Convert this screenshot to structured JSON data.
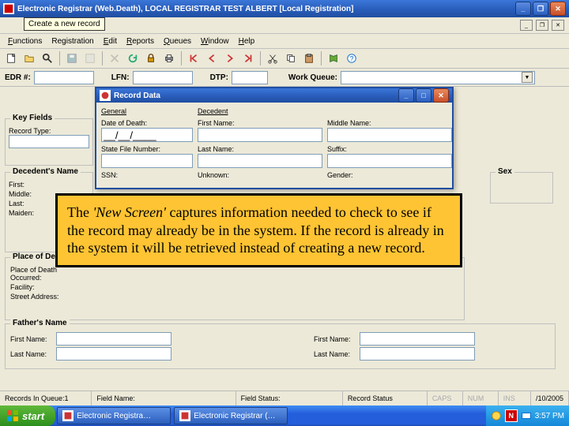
{
  "app": {
    "title": "Electronic Registrar (Web.Death), LOCAL REGISTRAR TEST   ALBERT   [Local Registration]"
  },
  "menu": {
    "functions": "Functions",
    "registration": "Registration",
    "edit": "Edit",
    "reports": "Reports",
    "queues": "Queues",
    "window": "Window",
    "help": "Help"
  },
  "toolbar": {
    "tooltip_new": "Create a new record"
  },
  "filter": {
    "edr": "EDR #:",
    "lfn": "LFN:",
    "dtp": "DTP:",
    "workqueue": "Work Queue:"
  },
  "groups": {
    "keyfields": "Key Fields",
    "decedentname": "Decedent's Name",
    "sex": "Sex",
    "placeofdeath": "Place of Death",
    "recordtype": "Record Type:",
    "deathoccurred": "Place of Death Occurred:",
    "facility": "Facility:",
    "streetaddr": "Street Address:",
    "first": "First:",
    "middle": "Middle:",
    "last": "Last:",
    "maiden": "Maiden:",
    "firstname": "First Name:",
    "lastname": "Last Name:",
    "fathersname": "Father's Name"
  },
  "dialog": {
    "title": "Record Data",
    "general": "General",
    "decedent": "Decedent",
    "dateofdeath": "Date of Death:",
    "dod_value": "__/__/____",
    "firstname": "First Name:",
    "middlename": "Middle Name:",
    "sfn": "State File Number:",
    "lastname": "Last Name:",
    "suffix": "Suffix:",
    "ssn": "SSN:",
    "unk": "Unknown:",
    "gender": "Gender:"
  },
  "callout": {
    "text": "The 'New Screen' captures information needed to check to see if the record may already be in the system. If the record is already in the system it will be retrieved instead of creating a new record."
  },
  "status": {
    "queue": "Records In Queue:1",
    "fieldname": "Field Name:",
    "fieldstatus": "Field Status:",
    "recordstatus": "Record Status",
    "caps": "CAPS",
    "num": "NUM",
    "ins": "INS",
    "date": "/10/2005"
  },
  "taskbar": {
    "start": "start",
    "task1": "Electronic Registra…",
    "task2": "Electronic Registrar (…",
    "n": "N",
    "time": "3:57 PM"
  }
}
